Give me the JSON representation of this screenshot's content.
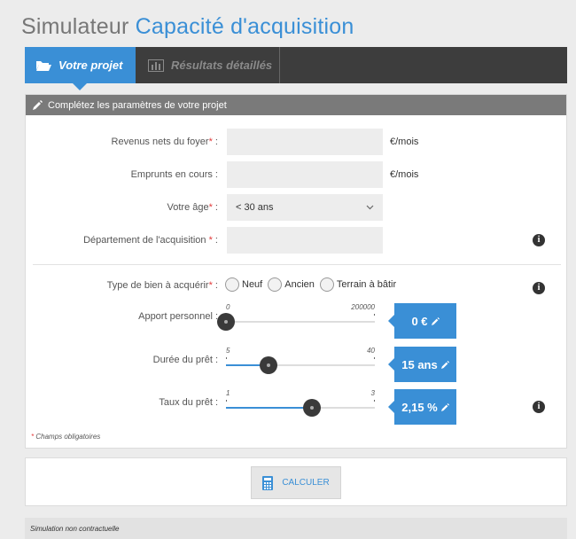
{
  "header": {
    "title_prefix": "Simulateur",
    "title_accent": "Capacité d'acquisition"
  },
  "tabs": [
    {
      "label": "Votre projet",
      "active": true,
      "icon": "folder-open-icon"
    },
    {
      "label": "Résultats détaillés",
      "active": false,
      "icon": "bar-chart-icon"
    }
  ],
  "panel": {
    "heading": "Complétez les paramètres de votre projet",
    "heading_icon": "pencil-icon"
  },
  "form": {
    "revenus": {
      "label": "Revenus nets du foyer",
      "required_mark": "*",
      "suffix": " :",
      "value": "",
      "unit": "€/mois"
    },
    "emprunts": {
      "label": "Emprunts en cours :",
      "value": "",
      "unit": "€/mois"
    },
    "age": {
      "label": "Votre âge",
      "required_mark": "*",
      "suffix": " :",
      "selected": "< 30 ans"
    },
    "departement": {
      "label": "Département de l'acquisition",
      "required_mark": " *",
      "suffix": " :",
      "value": ""
    },
    "type_bien": {
      "label": "Type de bien à acquérir",
      "required_mark": "*",
      "suffix": " :",
      "options": [
        "Neuf",
        "Ancien",
        "Terrain à bâtir"
      ]
    },
    "apport": {
      "label": "Apport personnel :",
      "min": "0",
      "max": "200000",
      "value": 0,
      "display": "0 €"
    },
    "duree": {
      "label": "Durée du prêt :",
      "min": "5",
      "max": "40",
      "value": 15,
      "display": "15 ans"
    },
    "taux": {
      "label": "Taux du prêt :",
      "min": "1",
      "max": "3",
      "value": 2.15,
      "display": "2,15 %"
    }
  },
  "required_note": {
    "mark": "*",
    "text": " Champs obligatoires"
  },
  "calculate_button": {
    "label": "CALCULER",
    "icon": "calculator-icon"
  },
  "footer": {
    "text": "Simulation non contractuelle"
  },
  "info_icon": "i",
  "colors": {
    "accent": "#3a8fd6",
    "required": "#e23b3b",
    "dark_bar": "#3d3d3d",
    "panel_head": "#7a7a7a"
  }
}
